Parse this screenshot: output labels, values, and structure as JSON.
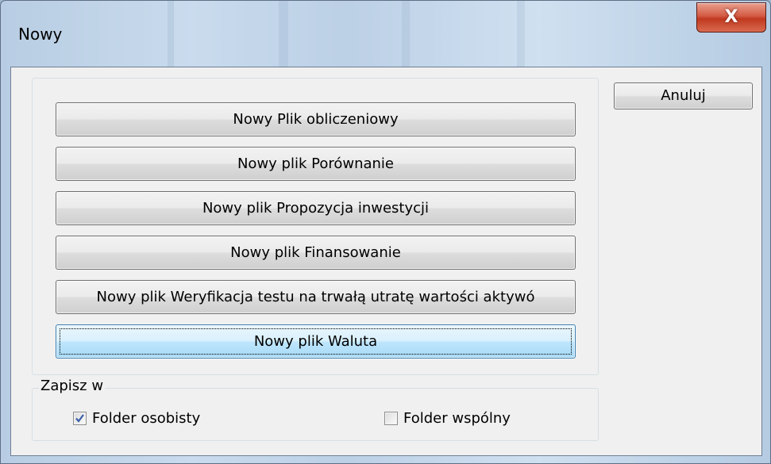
{
  "window": {
    "title": "Nowy",
    "close_glyph": "X"
  },
  "buttons": {
    "calc": "Nowy Plik obliczeniowy",
    "compare": "Nowy plik Porównanie",
    "proposal": "Nowy plik Propozycja inwestycji",
    "financing": "Nowy plik Finansowanie",
    "impairment": "Nowy plik Weryfikacja testu na trwałą utratę wartości aktywó",
    "currency": "Nowy plik Waluta",
    "cancel": "Anuluj"
  },
  "save_in": {
    "legend": "Zapisz w",
    "personal": {
      "label": "Folder osobisty",
      "checked": true
    },
    "shared": {
      "label": "Folder wspólny",
      "checked": false
    }
  },
  "icons": {
    "close": "close-icon",
    "check": "checkmark-icon"
  },
  "colors": {
    "close_button": "#c0391f",
    "focused_button": "#bee6fd",
    "checkmark": "#3a5fa8"
  }
}
